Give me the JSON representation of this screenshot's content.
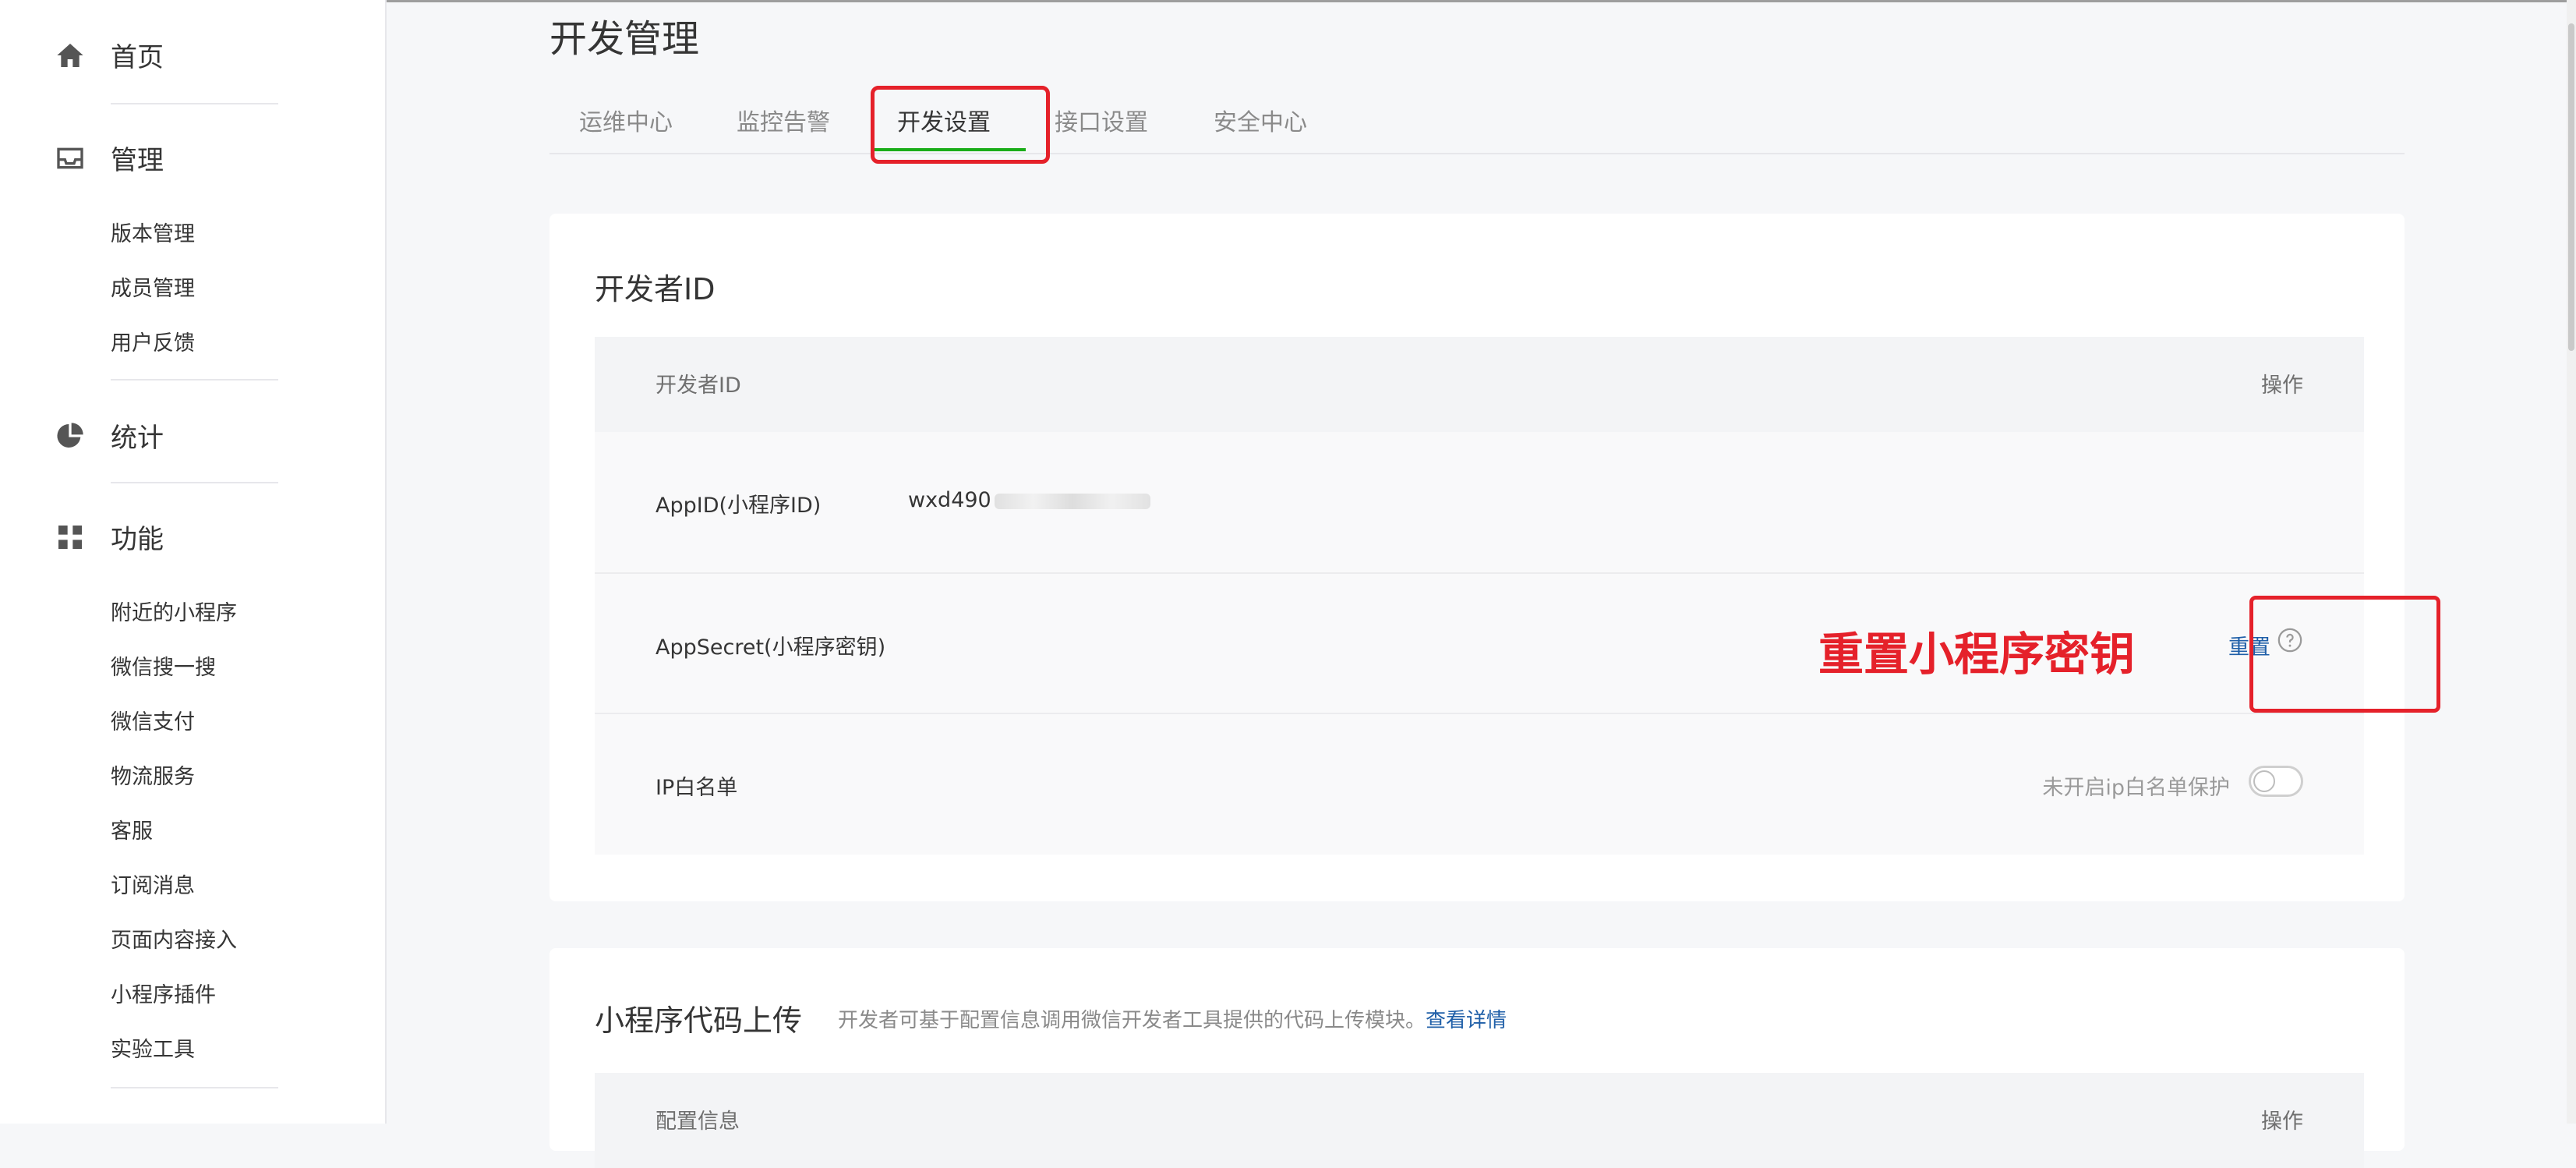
{
  "sidebar": {
    "home": {
      "label": "首页",
      "icon": "home-icon"
    },
    "manage": {
      "label": "管理",
      "icon": "inbox-icon",
      "items": [
        "版本管理",
        "成员管理",
        "用户反馈"
      ]
    },
    "stats": {
      "label": "统计",
      "icon": "pie-chart-icon"
    },
    "features": {
      "label": "功能",
      "icon": "grid-icon",
      "items": [
        "附近的小程序",
        "微信搜一搜",
        "微信支付",
        "物流服务",
        "客服",
        "订阅消息",
        "页面内容接入",
        "小程序插件",
        "实验工具"
      ]
    }
  },
  "page": {
    "title": "开发管理"
  },
  "tabs": [
    {
      "label": "运维中心"
    },
    {
      "label": "监控告警"
    },
    {
      "label": "开发设置",
      "active": true
    },
    {
      "label": "接口设置"
    },
    {
      "label": "安全中心"
    }
  ],
  "developer_card": {
    "title": "开发者ID",
    "table_header": {
      "col1": "开发者ID",
      "col2": "操作"
    },
    "rows": {
      "appid": {
        "label": "AppID(小程序ID)",
        "value": "wxd490"
      },
      "appsecret": {
        "label": "AppSecret(小程序密钥)",
        "action": "重置",
        "annotation": "重置小程序密钥"
      },
      "ip": {
        "label": "IP白名单",
        "note": "未开启ip白名单保护",
        "toggle_on": false
      }
    }
  },
  "upload_card": {
    "title": "小程序代码上传",
    "desc": "开发者可基于配置信息调用微信开发者工具提供的代码上传模块。",
    "link": "查看详情",
    "table_header": {
      "col1": "配置信息",
      "col2": "操作"
    }
  },
  "colors": {
    "accent_green": "#1aad19",
    "annotation_red": "#e5212a",
    "link_blue": "#1f5fa8"
  }
}
